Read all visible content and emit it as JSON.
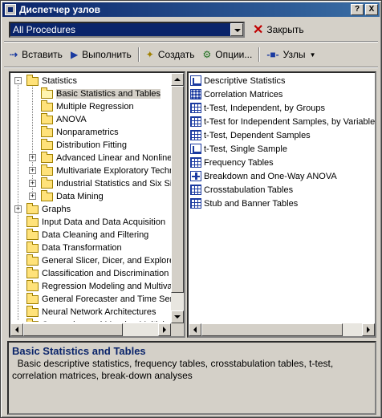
{
  "window": {
    "title": "Диспетчер узлов",
    "help": "?",
    "close": "X"
  },
  "procedures": {
    "selected": "All Procedures",
    "close_label": "Закрыть"
  },
  "toolbar": {
    "insert": "Вставить",
    "run": "Выполнить",
    "create": "Создать",
    "options": "Опции...",
    "nodes": "Узлы"
  },
  "tree": {
    "items": [
      {
        "label": "Statistics",
        "expanded": true
      },
      {
        "label": "Basic Statistics and Tables",
        "selected": true
      },
      {
        "label": "Multiple Regression"
      },
      {
        "label": "ANOVA"
      },
      {
        "label": "Nonparametrics"
      },
      {
        "label": "Distribution Fitting"
      },
      {
        "label": "Advanced Linear and Nonline"
      },
      {
        "label": "Multivariate Exploratory Techr"
      },
      {
        "label": "Industrial Statistics and Six Sig"
      },
      {
        "label": "Data Mining"
      },
      {
        "label": "Graphs"
      },
      {
        "label": "Input Data and Data Acquisition"
      },
      {
        "label": "Data Cleaning and Filtering"
      },
      {
        "label": "Data Transformation"
      },
      {
        "label": "General Slicer, Dicer, and Explore"
      },
      {
        "label": "Classification and Discrimination"
      },
      {
        "label": "Regression Modeling and Multivar"
      },
      {
        "label": "General Forecaster and Time Seri"
      },
      {
        "label": "Neural Network Architectures"
      },
      {
        "label": "Comparing and Merging Multiple D"
      }
    ]
  },
  "list": {
    "items": [
      {
        "label": "Descriptive Statistics",
        "icon": "descriptive-stats-icon"
      },
      {
        "label": "Correlation Matrices",
        "icon": "correlation-matrix-icon"
      },
      {
        "label": "t-Test, Independent, by Groups",
        "icon": "ttest-groups-icon"
      },
      {
        "label": "t-Test for Independent Samples, by Variables",
        "icon": "ttest-variables-icon"
      },
      {
        "label": "t-Test, Dependent Samples",
        "icon": "ttest-dependent-icon"
      },
      {
        "label": "t-Test, Single Sample",
        "icon": "ttest-single-icon"
      },
      {
        "label": "Frequency Tables",
        "icon": "frequency-table-icon"
      },
      {
        "label": "Breakdown and One-Way ANOVA",
        "icon": "breakdown-icon"
      },
      {
        "label": "Crosstabulation Tables",
        "icon": "crosstab-icon"
      },
      {
        "label": "Stub and Banner Tables",
        "icon": "stub-banner-icon"
      }
    ]
  },
  "description": {
    "title": "Basic Statistics and Tables",
    "text": "Basic descriptive statistics, frequency tables, crosstabulation tables, t-test, correlation matrices, break-down analyses"
  },
  "colors": {
    "title_bar": "#0a246a",
    "face": "#d4d0c8",
    "desc_title": "#0a246a"
  }
}
